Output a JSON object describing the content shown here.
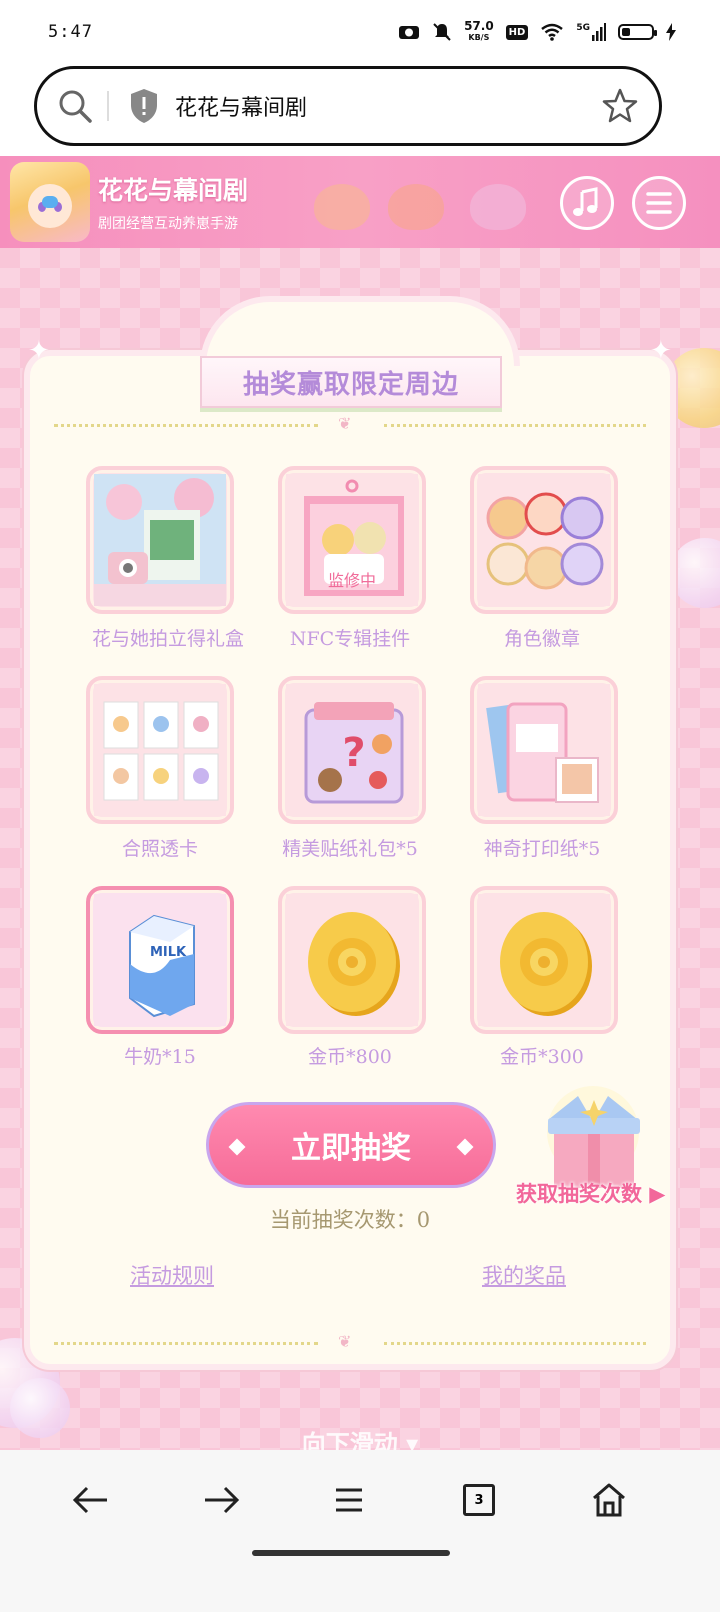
{
  "status_bar": {
    "time": "5:47",
    "net_speed": "57.0",
    "net_unit": "KB/S",
    "hd": "HD",
    "signal": "5G"
  },
  "address_bar": {
    "text": "花花与幕间剧"
  },
  "site_header": {
    "title": "花花与幕间剧",
    "subtitle": "剧团经营互动养崽手游"
  },
  "lottery": {
    "banner_title": "抽奖赢取限定周边",
    "prizes": [
      {
        "label": "花与她拍立得礼盒"
      },
      {
        "label": "NFC专辑挂件"
      },
      {
        "label": "角色徽章"
      },
      {
        "label": "合照透卡"
      },
      {
        "label": "精美贴纸礼包*5"
      },
      {
        "label": "神奇打印纸*5"
      },
      {
        "label": "牛奶*15"
      },
      {
        "label": "金币*800"
      },
      {
        "label": "金币*300"
      }
    ],
    "draw_button": "立即抽奖",
    "draw_count": "当前抽奖次数：0",
    "rules_link": "活动规则",
    "my_prizes_link": "我的奖品",
    "get_chances": "获取抽奖次数 ▶",
    "scroll_hint": "向下滑动 ▾",
    "milk_text": "MILK",
    "reviewing_mark": "监修中"
  },
  "bottom_nav": {
    "tab_count": "3"
  },
  "colors": {
    "header_pink": "#f68fbd",
    "accent_lavender": "#c59be0",
    "draw_button": "#f66c98"
  }
}
